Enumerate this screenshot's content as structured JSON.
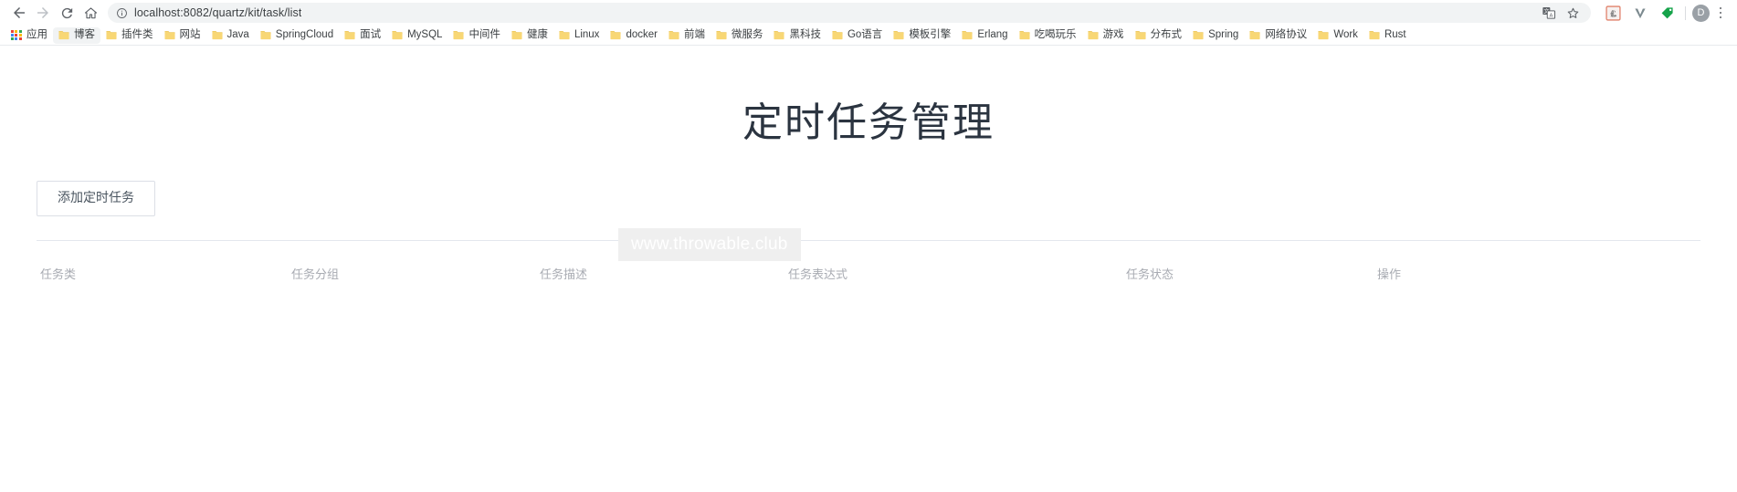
{
  "browser": {
    "nav": {
      "back_label": "Back",
      "forward_label": "Forward",
      "reload_label": "Reload",
      "home_label": "Home"
    },
    "omnibox": {
      "url": "localhost:8082/quartz/kit/task/list",
      "site_info_label": "View site information",
      "translate_label": "Translate this page",
      "bookmark_label": "Bookmark this tab"
    },
    "extensions": [
      {
        "name": "adobe-acrobat-extension",
        "label": "Adobe Acrobat"
      },
      {
        "name": "vimium-extension",
        "label": "V"
      },
      {
        "name": "tag-extension",
        "label": "Tag"
      }
    ],
    "profile": {
      "initial": "D",
      "label": "Profile"
    },
    "menu_label": "Customize and control Google Chrome",
    "bookmarks": [
      {
        "label": "应用",
        "icon": "apps-grid-icon",
        "hovered": false
      },
      {
        "label": "博客",
        "icon": "folder-icon",
        "hovered": true
      },
      {
        "label": "插件类",
        "icon": "folder-icon",
        "hovered": false
      },
      {
        "label": "网站",
        "icon": "folder-icon",
        "hovered": false
      },
      {
        "label": "Java",
        "icon": "folder-icon",
        "hovered": false
      },
      {
        "label": "SpringCloud",
        "icon": "folder-icon",
        "hovered": false
      },
      {
        "label": "面试",
        "icon": "folder-icon",
        "hovered": false
      },
      {
        "label": "MySQL",
        "icon": "folder-icon",
        "hovered": false
      },
      {
        "label": "中间件",
        "icon": "folder-icon",
        "hovered": false
      },
      {
        "label": "健康",
        "icon": "folder-icon",
        "hovered": false
      },
      {
        "label": "Linux",
        "icon": "folder-icon",
        "hovered": false
      },
      {
        "label": "docker",
        "icon": "folder-icon",
        "hovered": false
      },
      {
        "label": "前端",
        "icon": "folder-icon",
        "hovered": false
      },
      {
        "label": "微服务",
        "icon": "folder-icon",
        "hovered": false
      },
      {
        "label": "黑科技",
        "icon": "folder-icon",
        "hovered": false
      },
      {
        "label": "Go语言",
        "icon": "folder-icon",
        "hovered": false
      },
      {
        "label": "模板引擎",
        "icon": "folder-icon",
        "hovered": false
      },
      {
        "label": "Erlang",
        "icon": "folder-icon",
        "hovered": false
      },
      {
        "label": "吃喝玩乐",
        "icon": "folder-icon",
        "hovered": false
      },
      {
        "label": "游戏",
        "icon": "folder-icon",
        "hovered": false
      },
      {
        "label": "分布式",
        "icon": "folder-icon",
        "hovered": false
      },
      {
        "label": "Spring",
        "icon": "folder-icon",
        "hovered": false
      },
      {
        "label": "网络协议",
        "icon": "folder-icon",
        "hovered": false
      },
      {
        "label": "Work",
        "icon": "folder-icon",
        "hovered": false
      },
      {
        "label": "Rust",
        "icon": "folder-icon",
        "hovered": false
      }
    ]
  },
  "page": {
    "title": "定时任务管理",
    "add_task_button": "添加定时任务",
    "watermark": "www.throwable.club",
    "table": {
      "columns": [
        "任务类",
        "任务分组",
        "任务描述",
        "任务表达式",
        "任务状态",
        "操作"
      ],
      "rows": []
    }
  },
  "colors": {
    "folder_yellow": "#f8d775",
    "title_text": "#2b3440",
    "header_text": "#a8abb2",
    "border": "#e4e7ed",
    "watermark_bg": "#efefef"
  }
}
